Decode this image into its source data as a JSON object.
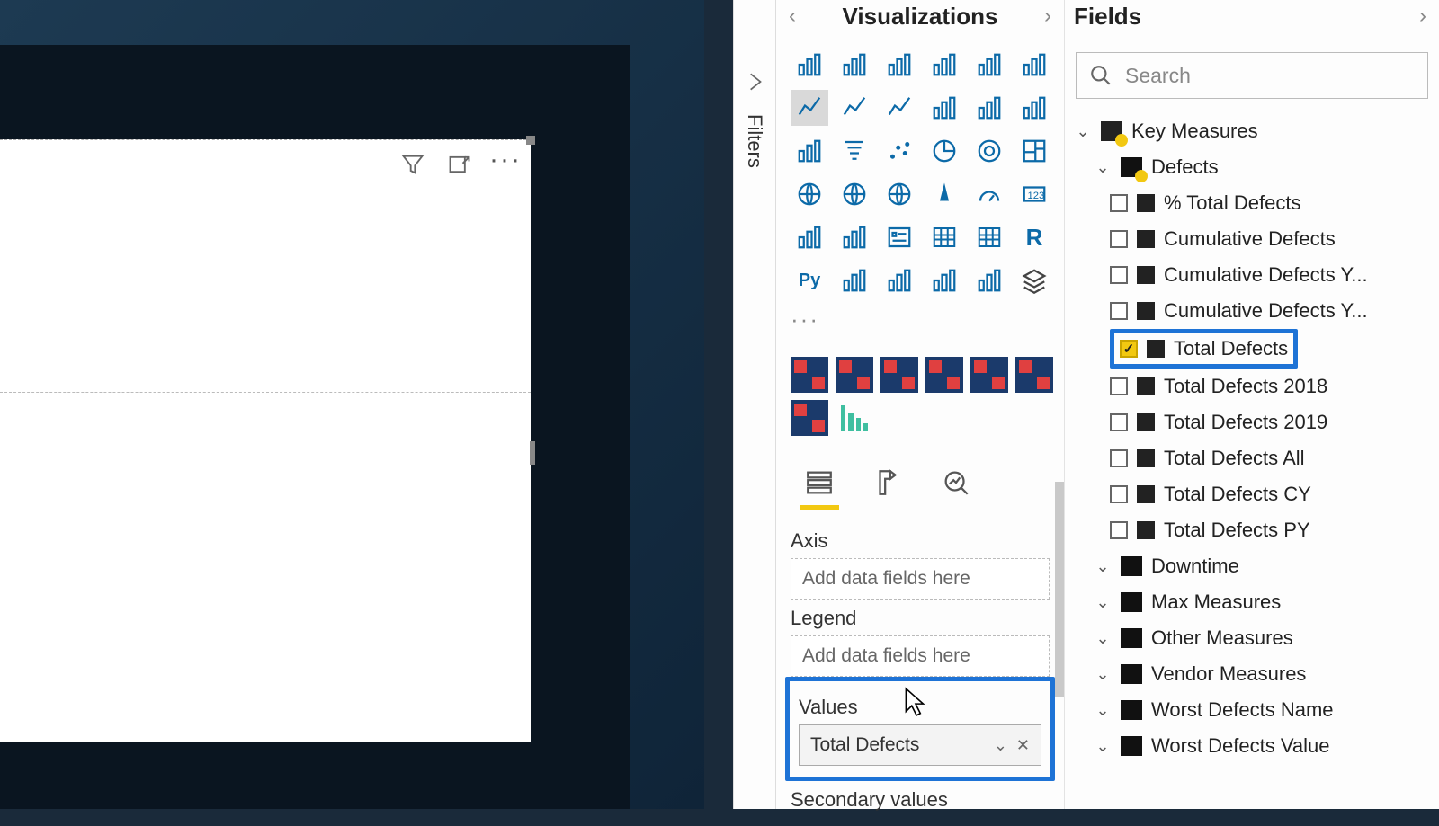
{
  "panes": {
    "visualizations": {
      "title": "Visualizations"
    },
    "fields": {
      "title": "Fields"
    },
    "filters": {
      "label": "Filters"
    }
  },
  "search": {
    "placeholder": "Search"
  },
  "wells": {
    "axis": {
      "label": "Axis",
      "placeholder": "Add data fields here"
    },
    "legend": {
      "label": "Legend",
      "placeholder": "Add data fields here"
    },
    "values": {
      "label": "Values",
      "item": "Total Defects"
    },
    "secondary": {
      "label": "Secondary values"
    }
  },
  "tree": {
    "root": "Key Measures",
    "group_defects": "Defects",
    "items": [
      "% Total Defects",
      "Cumulative Defects",
      "Cumulative Defects Y...",
      "Cumulative Defects Y...",
      "Total Defects",
      "Total Defects 2018",
      "Total Defects 2019",
      "Total Defects All",
      "Total Defects CY",
      "Total Defects PY"
    ],
    "groups_collapsed": [
      "Downtime",
      "Max Measures",
      "Other Measures",
      "Vendor Measures",
      "Worst Defects Name",
      "Worst Defects Value"
    ]
  },
  "viz_icons": [
    "stacked-bar",
    "clustered-bar",
    "stacked-column",
    "clustered-column",
    "stacked-bar-100",
    "stacked-column-100",
    "line",
    "area",
    "stacked-area",
    "line-clustered",
    "line-stacked",
    "ribbon",
    "waterfall",
    "funnel",
    "scatter",
    "pie",
    "donut",
    "treemap",
    "map",
    "filled-map",
    "shape-map",
    "azure-map",
    "gauge",
    "card",
    "multi-card",
    "kpi",
    "slicer",
    "table",
    "matrix",
    "r-visual",
    "py-visual",
    "key-influencers",
    "decomposition",
    "qa",
    "paginated",
    "more-visual"
  ],
  "highlight_field_index": 4
}
